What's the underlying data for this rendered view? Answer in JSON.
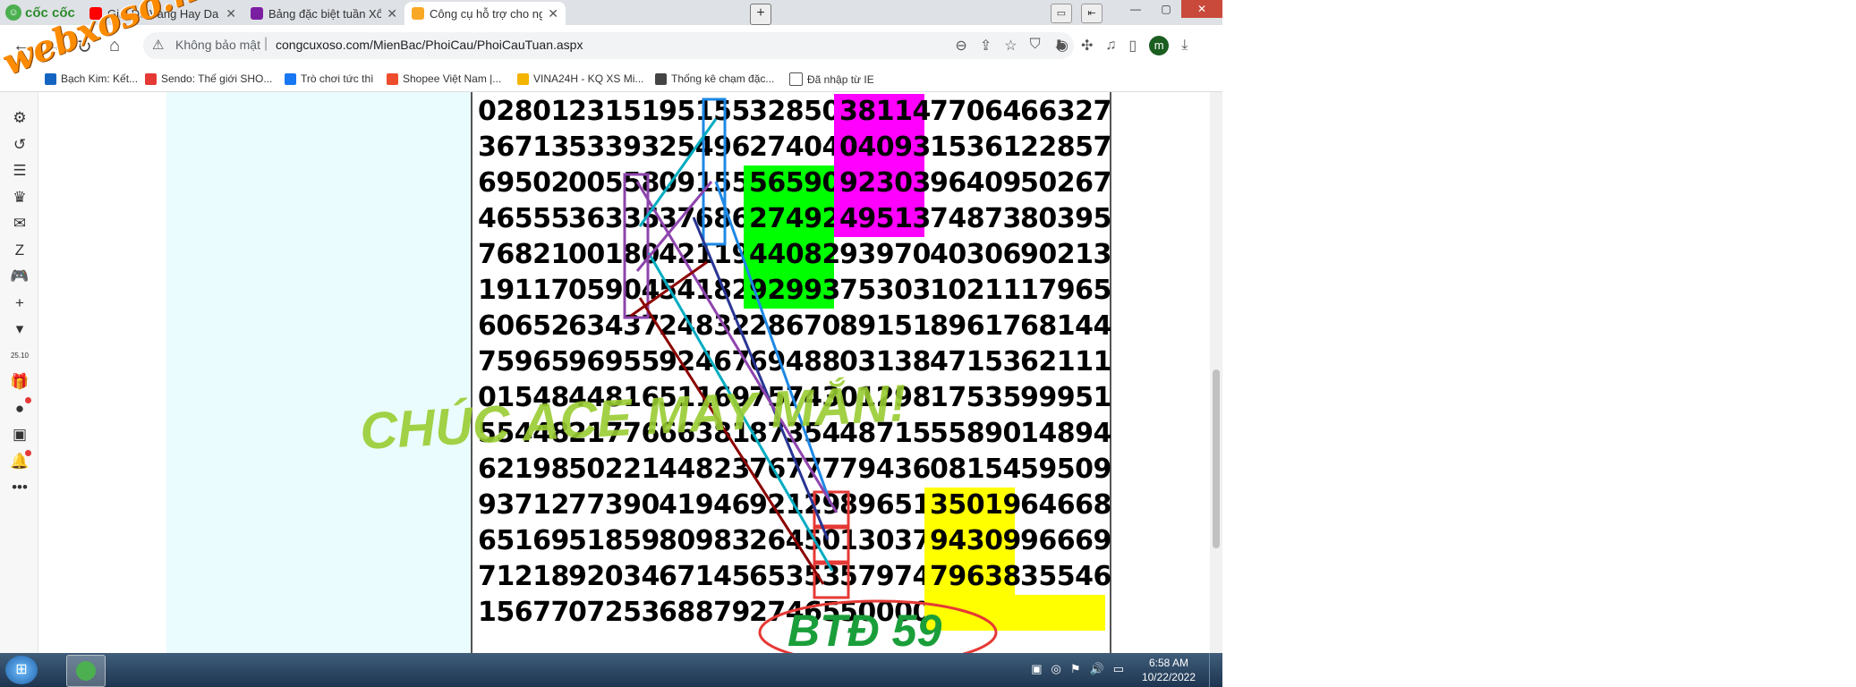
{
  "watermark": "webxoso.net",
  "browser": {
    "brand": "cốc cốc",
    "tabs": [
      {
        "title": "Giai Đề Vàng Hay Da Diết Đ",
        "color": "#ff0000"
      },
      {
        "title": "Bảng đặc biệt tuần Xổ Số Tru",
        "color": "#7b1fa2"
      },
      {
        "title": "Công cụ hỗ trợ cho người ch",
        "color": "#f9a825"
      }
    ],
    "new_tab": "+",
    "window_buttons": {
      "minimize": "—",
      "maximize": "▢",
      "close": "✕"
    }
  },
  "toolbar": {
    "back": "←",
    "forward": "→",
    "reload": "↻",
    "home": "⌂",
    "security_icon": "⚠",
    "security_text": "Không bảo mật",
    "separator": "|",
    "url": "congcuxoso.com/MienBac/PhoiCau/PhoiCauTuan.aspx",
    "avatar": "m",
    "badge": "2"
  },
  "bookmarks": [
    {
      "label": "Bạch Kim: Kết...",
      "color": "#1565c0"
    },
    {
      "label": "Sendo: Thế giới SHO...",
      "color": "#e53935"
    },
    {
      "label": "Trò chơi tức thì",
      "color": "#1877f2"
    },
    {
      "label": "Shopee Việt Nam |...",
      "color": "#ee4d2d"
    },
    {
      "label": "VINA24H - KQ XS Mi...",
      "color": "#f4b400"
    },
    {
      "label": "Thống kê chạm đặc...",
      "color": "#444444"
    },
    {
      "label": "Đã nhập từ IE",
      "color": "#ffffff"
    }
  ],
  "sidebar_icons": [
    {
      "name": "settings-icon",
      "glyph": "⚙"
    },
    {
      "name": "history-icon",
      "glyph": "↺"
    },
    {
      "name": "list-icon",
      "glyph": "☰"
    },
    {
      "name": "crown-icon",
      "glyph": "♛"
    },
    {
      "name": "messenger-icon",
      "glyph": "✉"
    },
    {
      "name": "zalo-icon",
      "glyph": "Z"
    },
    {
      "name": "gamepad-icon",
      "glyph": "🎮"
    },
    {
      "name": "add-icon",
      "glyph": "+"
    },
    {
      "name": "flag-icon",
      "glyph": "▾"
    },
    {
      "name": "calendar-icon",
      "glyph": "25.10"
    },
    {
      "name": "gift-icon",
      "glyph": "🎁"
    },
    {
      "name": "chat-icon",
      "glyph": "●"
    },
    {
      "name": "shop-icon",
      "glyph": "▣"
    },
    {
      "name": "bell-icon",
      "glyph": "🔔"
    },
    {
      "name": "more-icon",
      "glyph": "•••"
    }
  ],
  "lottery_rows": [
    [
      "02801",
      "23151",
      "95155",
      "32850",
      "38114",
      "77064",
      "66327"
    ],
    [
      "36713",
      "53393",
      "25496",
      "27404",
      "04093",
      "15361",
      "22857"
    ],
    [
      "69502",
      "00558",
      "09155",
      "56590",
      "92303",
      "96409",
      "50267"
    ],
    [
      "46555",
      "36335",
      "37686",
      "27492",
      "49513",
      "74873",
      "80395"
    ],
    [
      "76821",
      "00180",
      "42119",
      "44082",
      "93970",
      "40306",
      "90213"
    ],
    [
      "19117",
      "05904",
      "54182",
      "92993",
      "75303",
      "10211",
      "17965"
    ],
    [
      "60652",
      "63437",
      "24832",
      "28670",
      "89151",
      "89617",
      "68144"
    ],
    [
      "75965",
      "96955",
      "92467",
      "69488",
      "03138",
      "47153",
      "62111"
    ],
    [
      "01548",
      "44816",
      "51169",
      "75743",
      "01298",
      "17535",
      "99951"
    ],
    [
      "55448",
      "21776",
      "66381",
      "87354",
      "48715",
      "55890",
      "14894"
    ],
    [
      "62198",
      "50221",
      "44823",
      "76777",
      "79436",
      "08154",
      "59509"
    ],
    [
      "93712",
      "77390",
      "41946",
      "92129",
      "89651",
      "35019",
      "64668"
    ],
    [
      "65169",
      "51859",
      "80983",
      "26450",
      "13037",
      "94309",
      "96669"
    ],
    [
      "71218",
      "92034",
      "67145",
      "65353",
      "57974",
      "79638",
      "35546"
    ],
    [
      "15677",
      "07253",
      "68879",
      "27465",
      "50000",
      "",
      ""
    ]
  ],
  "highlights": {
    "magenta": "#ff00ff",
    "green": "#00ff00",
    "yellow": "#ffff00"
  },
  "banner": "CHÚC ACE MAY MẮN!",
  "result_label": "BTĐ 59",
  "taskbar": {
    "time": "6:58 AM",
    "date": "10/22/2022"
  }
}
